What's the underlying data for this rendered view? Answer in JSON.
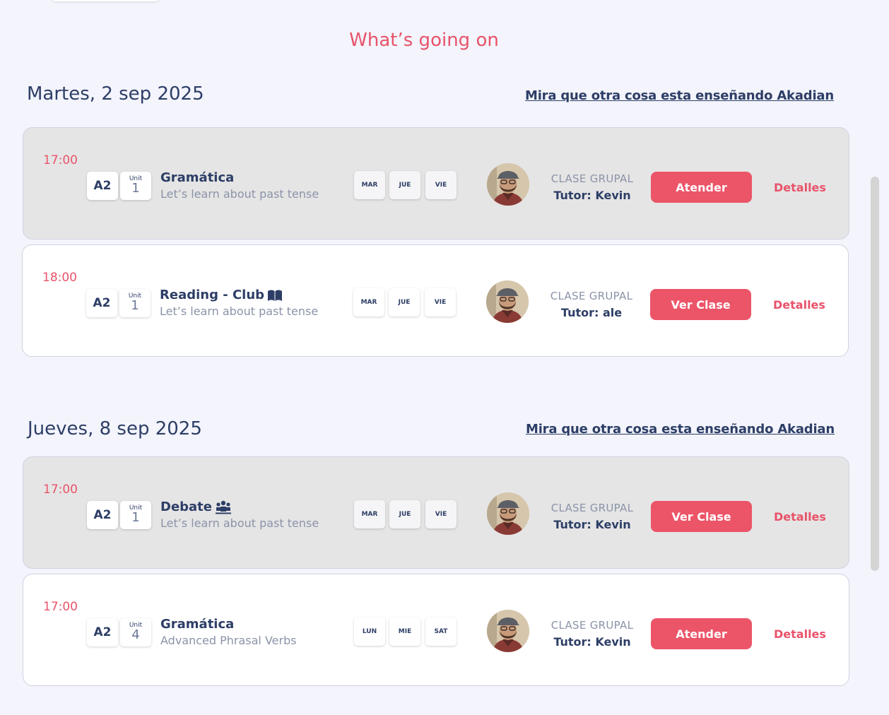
{
  "page": {
    "title": "What’s going on"
  },
  "colors": {
    "accent": "#ec5468",
    "navy": "#2d3e66",
    "muted": "#8b93a8",
    "background": "#f3f4fc"
  },
  "sections": [
    {
      "date": "Martes, 2 sep 2025",
      "link": "Mira que otra cosa esta enseñando Akadian",
      "classes": [
        {
          "style": "gray",
          "time": "17:00",
          "level": "A2",
          "unit_label": "Unit",
          "unit": "1",
          "name": "Gramática",
          "name_icon": "",
          "description": "Let’s learn about past tense",
          "days": [
            "MAR",
            "JUE",
            "VIE"
          ],
          "type": "CLASE GRUPAL",
          "tutor": "Tutor: Kevin",
          "action": "Atender",
          "details": "Detalles"
        },
        {
          "style": "white",
          "time": "18:00",
          "level": "A2",
          "unit_label": "Unit",
          "unit": "1",
          "name": "Reading - Club",
          "name_icon": "book-icon",
          "description": "Let’s learn about past tense",
          "days": [
            "MAR",
            "JUE",
            "VIE"
          ],
          "type": "CLASE GRUPAL",
          "tutor": "Tutor: ale",
          "action": "Ver Clase",
          "details": "Detalles"
        }
      ]
    },
    {
      "date": "Jueves, 8 sep 2025",
      "link": "Mira que otra cosa esta enseñando Akadian",
      "classes": [
        {
          "style": "gray",
          "time": "17:00",
          "level": "A2",
          "unit_label": "Unit",
          "unit": "1",
          "name": "Debate",
          "name_icon": "group-icon",
          "description": "Let’s learn about past tense",
          "days": [
            "MAR",
            "JUE",
            "VIE"
          ],
          "type": "CLASE GRUPAL",
          "tutor": "Tutor: Kevin",
          "action": "Ver Clase",
          "details": "Detalles"
        },
        {
          "style": "white",
          "time": "17:00",
          "level": "A2",
          "unit_label": "Unit",
          "unit": "4",
          "name": "Gramática",
          "name_icon": "",
          "description": "Advanced Phrasal Verbs",
          "days": [
            "LUN",
            "MIE",
            "SAT"
          ],
          "type": "CLASE GRUPAL",
          "tutor": "Tutor: Kevin",
          "action": "Atender",
          "details": "Detalles"
        }
      ]
    }
  ]
}
